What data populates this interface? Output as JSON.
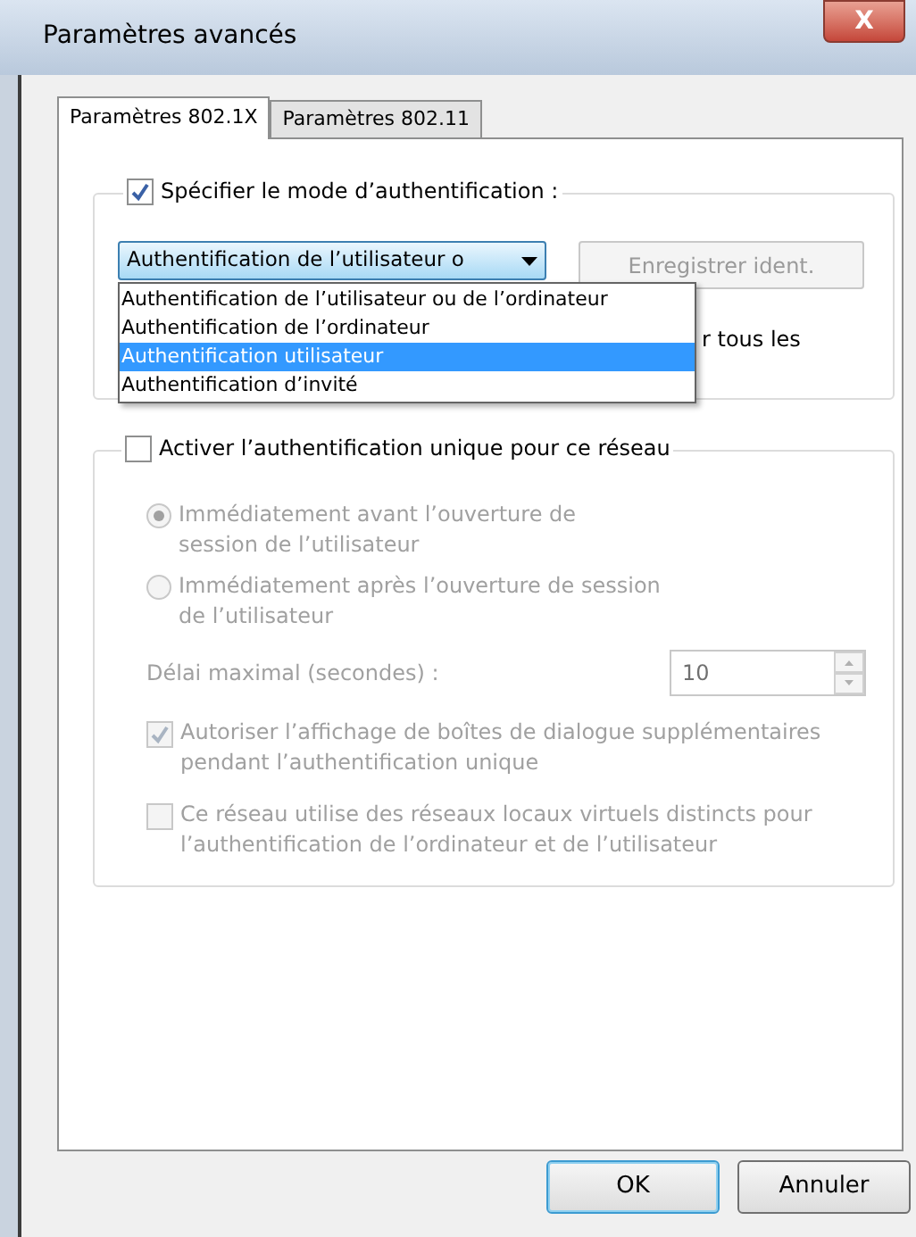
{
  "window": {
    "title": "Paramètres avancés",
    "close": "X"
  },
  "tabs": [
    {
      "label": "Paramètres 802.1X",
      "selected": true
    },
    {
      "label": "Paramètres 802.11",
      "selected": false
    }
  ],
  "auth_group": {
    "checkbox": {
      "label": "Spécifier le mode d’authentification :",
      "checked": true
    },
    "combo": {
      "value": "Authentification de l’utilisateur o",
      "expanded": true,
      "options": [
        {
          "label": "Authentification de l’utilisateur ou de l’ordinateur",
          "selected": false
        },
        {
          "label": "Authentification de l’ordinateur",
          "selected": false
        },
        {
          "label": "Authentification utilisateur",
          "selected": true
        },
        {
          "label": "Authentification d’invité",
          "selected": false
        }
      ]
    },
    "save_button": {
      "label": "Enregistrer ident.",
      "disabled": true
    },
    "partial_text": "r tous les"
  },
  "sso_group": {
    "checkbox": {
      "label": "Activer l’authentification unique pour ce réseau",
      "checked": false
    },
    "radios": [
      {
        "label": "Immédiatement avant l’ouverture de session de l’utilisateur",
        "selected": true,
        "disabled": true
      },
      {
        "label": "Immédiatement après l’ouverture de session de l’utilisateur",
        "selected": false,
        "disabled": true
      }
    ],
    "delay": {
      "label": "Délai maximal (secondes) :",
      "value": "10",
      "disabled": true
    },
    "options": [
      {
        "label": "Autoriser l’affichage de boîtes de dialogue supplémentaires pendant l’authentification unique",
        "checked": true,
        "disabled": true
      },
      {
        "label": "Ce réseau utilise des réseaux locaux virtuels distincts pour l’authentification de l’ordinateur et de l’utilisateur",
        "checked": false,
        "disabled": true
      }
    ]
  },
  "buttons": [
    {
      "label": "OK",
      "default": true
    },
    {
      "label": "Annuler",
      "default": false
    }
  ]
}
